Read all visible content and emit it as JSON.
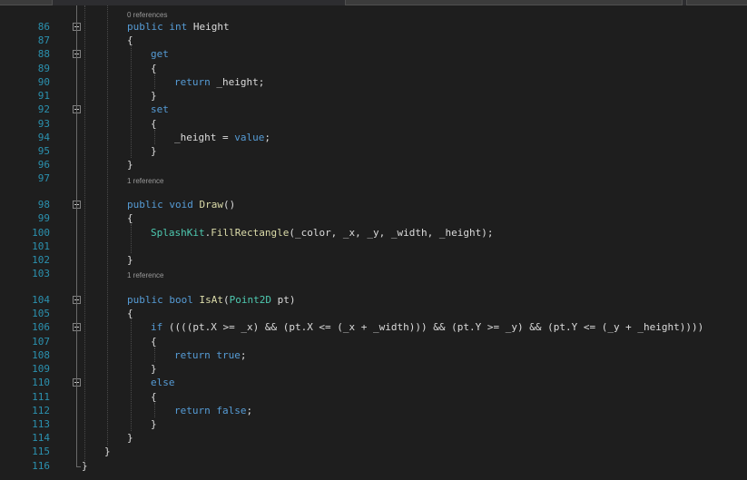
{
  "editor": {
    "codelens": [
      {
        "after_line": 85,
        "text": "0 references"
      },
      {
        "after_line": 97,
        "text": "1 reference"
      },
      {
        "after_line": 103,
        "text": "1 reference"
      }
    ],
    "lines": [
      {
        "n": "86",
        "tokens": [
          [
            "kw",
            "public"
          ],
          [
            "tx",
            " "
          ],
          [
            "kw",
            "int"
          ],
          [
            "tx",
            " Height"
          ]
        ],
        "indent": 2,
        "fold": true
      },
      {
        "n": "87",
        "tokens": [
          [
            "tx",
            "{"
          ]
        ],
        "indent": 2
      },
      {
        "n": "88",
        "tokens": [
          [
            "kw",
            "get"
          ]
        ],
        "indent": 3,
        "fold": true
      },
      {
        "n": "89",
        "tokens": [
          [
            "tx",
            "{"
          ]
        ],
        "indent": 3
      },
      {
        "n": "90",
        "tokens": [
          [
            "kw",
            "return"
          ],
          [
            "tx",
            " _height;"
          ]
        ],
        "indent": 4
      },
      {
        "n": "91",
        "tokens": [
          [
            "tx",
            "}"
          ]
        ],
        "indent": 3
      },
      {
        "n": "92",
        "tokens": [
          [
            "kw",
            "set"
          ]
        ],
        "indent": 3,
        "fold": true
      },
      {
        "n": "93",
        "tokens": [
          [
            "tx",
            "{"
          ]
        ],
        "indent": 3
      },
      {
        "n": "94",
        "tokens": [
          [
            "tx",
            "_height = "
          ],
          [
            "kw",
            "value"
          ],
          [
            "tx",
            ";"
          ]
        ],
        "indent": 4
      },
      {
        "n": "95",
        "tokens": [
          [
            "tx",
            "}"
          ]
        ],
        "indent": 3
      },
      {
        "n": "96",
        "tokens": [
          [
            "tx",
            "}"
          ]
        ],
        "indent": 2
      },
      {
        "n": "97",
        "tokens": [],
        "indent": 2
      },
      {
        "n": "98",
        "tokens": [
          [
            "kw",
            "public"
          ],
          [
            "tx",
            " "
          ],
          [
            "kw",
            "void"
          ],
          [
            "tx",
            " "
          ],
          [
            "fn",
            "Draw"
          ],
          [
            "tx",
            "()"
          ]
        ],
        "indent": 2,
        "fold": true
      },
      {
        "n": "99",
        "tokens": [
          [
            "tx",
            "{"
          ]
        ],
        "indent": 2
      },
      {
        "n": "100",
        "tokens": [
          [
            "ty",
            "SplashKit"
          ],
          [
            "tx",
            "."
          ],
          [
            "fn",
            "FillRectangle"
          ],
          [
            "tx",
            "(_color, _x, _y, _width, _height);"
          ]
        ],
        "indent": 3
      },
      {
        "n": "101",
        "tokens": [],
        "indent": 3
      },
      {
        "n": "102",
        "tokens": [
          [
            "tx",
            "}"
          ]
        ],
        "indent": 2
      },
      {
        "n": "103",
        "tokens": [],
        "indent": 2
      },
      {
        "n": "104",
        "tokens": [
          [
            "kw",
            "public"
          ],
          [
            "tx",
            " "
          ],
          [
            "kw",
            "bool"
          ],
          [
            "tx",
            " "
          ],
          [
            "fn",
            "IsAt"
          ],
          [
            "tx",
            "("
          ],
          [
            "ty",
            "Point2D"
          ],
          [
            "tx",
            " pt)"
          ]
        ],
        "indent": 2,
        "fold": true
      },
      {
        "n": "105",
        "tokens": [
          [
            "tx",
            "{"
          ]
        ],
        "indent": 2
      },
      {
        "n": "106",
        "tokens": [
          [
            "kw",
            "if"
          ],
          [
            "tx",
            " ((((pt.X >= _x) && (pt.X <= (_x + _width))) && (pt.Y >= _y) && (pt.Y <= (_y + _height))))"
          ]
        ],
        "indent": 3,
        "fold": true
      },
      {
        "n": "107",
        "tokens": [
          [
            "tx",
            "{"
          ]
        ],
        "indent": 3
      },
      {
        "n": "108",
        "tokens": [
          [
            "kw",
            "return"
          ],
          [
            "tx",
            " "
          ],
          [
            "kw",
            "true"
          ],
          [
            "tx",
            ";"
          ]
        ],
        "indent": 4
      },
      {
        "n": "109",
        "tokens": [
          [
            "tx",
            "}"
          ]
        ],
        "indent": 3
      },
      {
        "n": "110",
        "tokens": [
          [
            "kw",
            "else"
          ]
        ],
        "indent": 3,
        "fold": true
      },
      {
        "n": "111",
        "tokens": [
          [
            "tx",
            "{"
          ]
        ],
        "indent": 3
      },
      {
        "n": "112",
        "tokens": [
          [
            "kw",
            "return"
          ],
          [
            "tx",
            " "
          ],
          [
            "kw",
            "false"
          ],
          [
            "tx",
            ";"
          ]
        ],
        "indent": 4
      },
      {
        "n": "113",
        "tokens": [
          [
            "tx",
            "}"
          ]
        ],
        "indent": 3
      },
      {
        "n": "114",
        "tokens": [
          [
            "tx",
            "}"
          ]
        ],
        "indent": 2
      },
      {
        "n": "115",
        "tokens": [
          [
            "tx",
            "}"
          ]
        ],
        "indent": 1
      },
      {
        "n": "116",
        "tokens": [
          [
            "tx",
            "}"
          ]
        ],
        "indent": 0
      }
    ]
  },
  "colors": {
    "background": "#1e1e1e",
    "line_number": "#2b91af",
    "keyword": "#569cd6",
    "type": "#4ec9b0",
    "method": "#dcdcaa",
    "text": "#dcdcdc",
    "codelens": "#999999"
  },
  "icons": {
    "fold": "collapse-box-icon"
  }
}
